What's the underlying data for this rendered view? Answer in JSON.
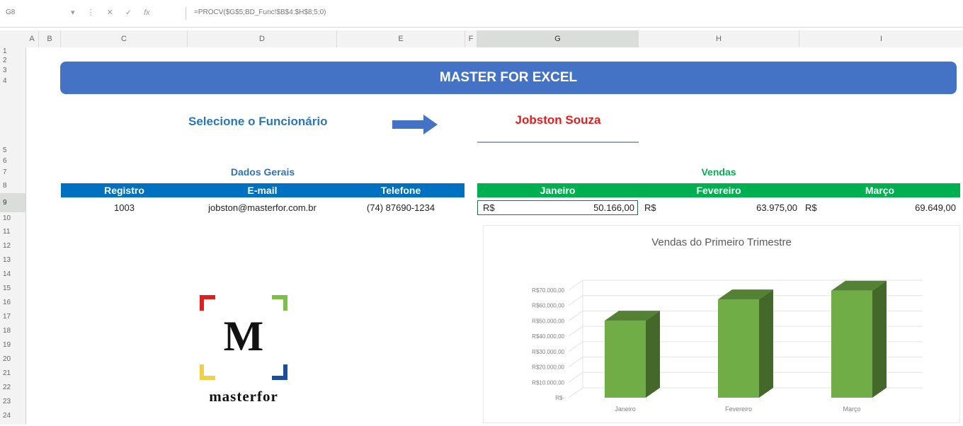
{
  "formula_bar": {
    "name_box": "G8",
    "buttons": [
      "▾",
      "⋮",
      "✕",
      "✓",
      "fx"
    ],
    "formula": "=PROCV($G$5;BD_Func!$B$4:$H$8;5;0)"
  },
  "columns": [
    "A",
    "B",
    "C",
    "D",
    "E",
    "F",
    "G",
    "H",
    "I"
  ],
  "selected_column": "G",
  "rows": [
    "1",
    "2",
    "3",
    "4",
    "5",
    "6",
    "7",
    "8",
    "9",
    "10",
    "11",
    "12",
    "13",
    "14",
    "15",
    "16",
    "17",
    "18",
    "19",
    "20",
    "21",
    "22",
    "23",
    "24"
  ],
  "selected_row": "9",
  "banner": {
    "title": "MASTER FOR EXCEL"
  },
  "selector": {
    "label": "Selecione o Funcionário",
    "employee": "Jobston Souza"
  },
  "dados_gerais": {
    "title": "Dados Gerais",
    "headers": [
      "Registro",
      "E-mail",
      "Telefone"
    ],
    "values": [
      "1003",
      "jobston@masterfor.com.br",
      "(74) 87690-1234"
    ]
  },
  "vendas": {
    "title": "Vendas",
    "headers": [
      "Janeiro",
      "Fevereiro",
      "Março"
    ],
    "currency": "R$",
    "values": [
      "50.166,00",
      "63.975,00",
      "69.649,00"
    ]
  },
  "logo": {
    "letter": "M",
    "text": "masterfor"
  },
  "colors": {
    "banner": "#4472c4",
    "blue_header": "#0070c0",
    "green_header": "#00b050",
    "employee_name": "#e02020",
    "selector_label": "#2e75b6",
    "bar_front": "#70ad47",
    "bar_top": "#548235",
    "bar_side": "#43682a"
  },
  "chart_data": {
    "type": "bar",
    "title": "Vendas do Primeiro Trimestre",
    "categories": [
      "Janeiro",
      "Fevereiro",
      "Março"
    ],
    "values": [
      50166,
      63975,
      69649
    ],
    "ylim": [
      0,
      70000
    ],
    "yticks": [
      "R$70.000,00",
      "R$60.000,00",
      "R$50.000,00",
      "R$40.000,00",
      "R$30.000,00",
      "R$20.000,00",
      "R$10.000,00",
      "R$-"
    ],
    "grid": true,
    "three_d": true
  }
}
